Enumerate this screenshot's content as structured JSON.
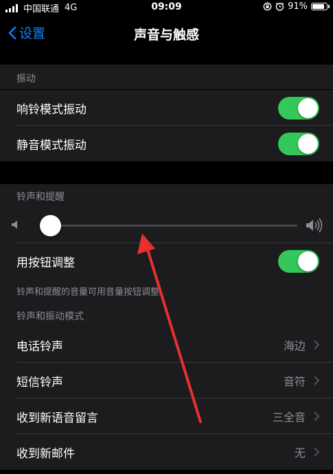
{
  "status": {
    "carrier": "中国联通",
    "network": "4G",
    "time": "09:09",
    "battery_percent": "91%",
    "battery_level": 0.91
  },
  "nav": {
    "back_label": "设置",
    "title": "声音与触感"
  },
  "vibration": {
    "header": "振动",
    "items": [
      {
        "label": "响铃模式振动",
        "on": true
      },
      {
        "label": "静音模式振动",
        "on": true
      }
    ]
  },
  "ringer": {
    "header": "铃声和提醒",
    "volume_level": 0.04,
    "button_adjust_label": "用按钮调整",
    "button_adjust_on": true,
    "footer": "铃声和提醒的音量可用音量按钮调整。"
  },
  "patterns": {
    "header": "铃声和振动模式",
    "items": [
      {
        "label": "电话铃声",
        "value": "海边"
      },
      {
        "label": "短信铃声",
        "value": "音符"
      },
      {
        "label": "收到新语音留言",
        "value": "三全音"
      },
      {
        "label": "收到新邮件",
        "value": "无"
      }
    ]
  },
  "colors": {
    "accent": "#0a84ff",
    "toggle_on": "#34c759",
    "annotation_arrow": "#e8302f"
  }
}
